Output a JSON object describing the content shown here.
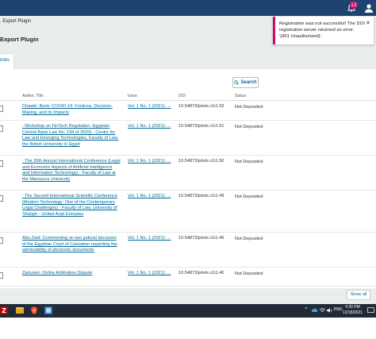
{
  "topbar": {
    "notification_count": "12"
  },
  "breadcrumb": "Export Plugin",
  "page_title": "Export Plugin",
  "tab_label": "icles",
  "search": {
    "label": "Search"
  },
  "table": {
    "headers": {
      "title": "Author; Title",
      "issue": "Issue",
      "doi": "DOI",
      "status": "Status"
    },
    "rows": [
      {
        "title": "Chawki: Book: COVID-19: Frictions, Decision-Making, and Its Impacts",
        "issue": "Vol. 1 No. 1 (2021): ...",
        "doi": "10.54873/jolets.v1i1.52",
        "status": "Not Deposited"
      },
      {
        "title": ": Workshop on FinTech Regulation: Egyptian Central Bank Law No. 194 of 2020) - Centre for Law and Emerging Technologies, Faculty of Law, the British University in Egypt",
        "issue": "Vol. 1 No. 1 (2021): ...",
        "doi": "10.54873/jolets.v1i1.51",
        "status": "Not Deposited"
      },
      {
        "title": ": The 20th Annual International Conference (Legal and Economic Aspects of Artificial Intelligence and Information Technology) - Faculty of Law at the Mansoura University",
        "issue": "Vol. 1 No. 1 (2021): ...",
        "doi": "10.54873/jolets.v1i1.50",
        "status": "Not Deposited"
      },
      {
        "title": ": The Second International Scientific Conference (Modern Technology: One of the Contemporary Legal Challenges) - Faculty of Law, University of Sharjah - United Arab Emirates",
        "issue": "Vol. 1 No. 1 (2021): ...",
        "doi": "10.54873/jolets.v1i1.49",
        "status": "Not Deposited"
      },
      {
        "title": "Abu Zeid: Commenting on two judicial decisions of the Egyptian Court of Cassation regarding the admissibility of electronic documents",
        "issue": "Vol. 1 No. 1 (2021): ...",
        "doi": "10.54873/jolets.v1i1.46",
        "status": "Not Deposited"
      },
      {
        "title": "Zamzam: Online Arbitration Dispute",
        "issue": "Vol. 1 No. 1 (2021): ...",
        "doi": "10.54873/jolets.v1i1.40",
        "status": "Not Deposited"
      }
    ]
  },
  "show_all": "Show all",
  "notification": {
    "message": "Registration was not successful! The DOI registration server returned an error: '{401 Unauthorized}'."
  },
  "taskbar": {
    "lang": "ENG",
    "time": "4:30 PM",
    "date": "12/18/2021"
  },
  "colors": {
    "link": "#006798",
    "accent": "#d00a6c",
    "header": "#1f4370"
  }
}
